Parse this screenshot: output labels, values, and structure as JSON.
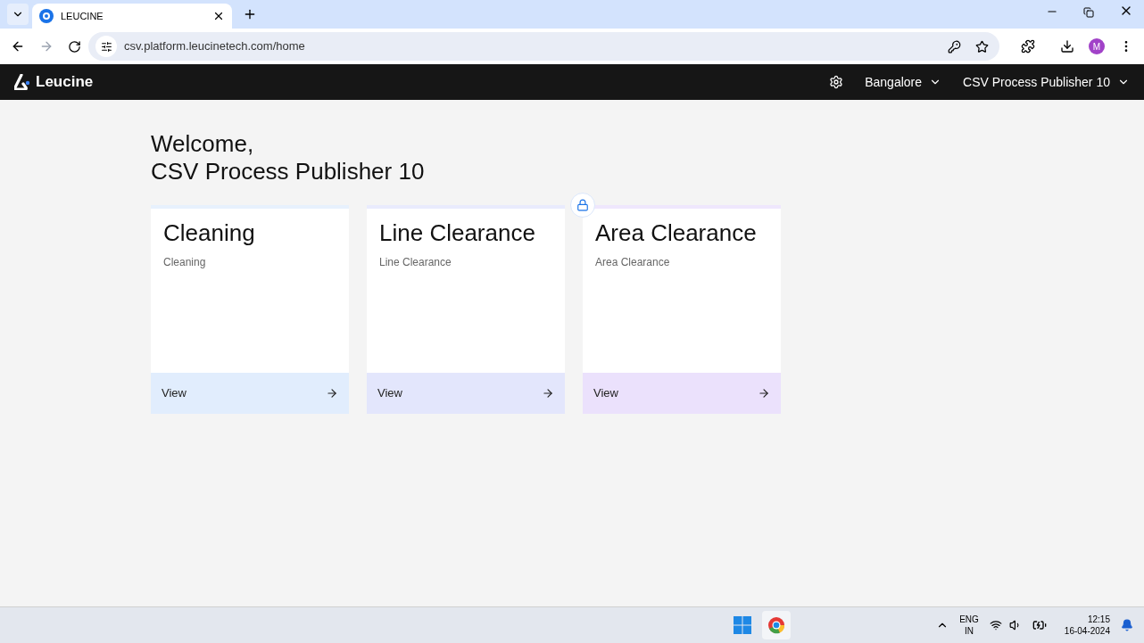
{
  "browser": {
    "tab_title": "LEUCINE",
    "url": "csv.platform.leucinetech.com/home",
    "profile_initial": "M"
  },
  "header": {
    "logo": "Leucine",
    "facility": "Bangalore",
    "user": "CSV Process Publisher 10"
  },
  "welcome": {
    "greeting": "Welcome,",
    "name": "CSV Process Publisher 10"
  },
  "cards": [
    {
      "title": "Cleaning",
      "subtitle": "Cleaning",
      "action": "View",
      "color": "#e1edfd",
      "locked": false
    },
    {
      "title": "Line Clearance",
      "subtitle": "Line Clearance",
      "action": "View",
      "color": "#e3e6fc",
      "locked": false
    },
    {
      "title": "Area Clearance",
      "subtitle": "Area Clearance",
      "action": "View",
      "color": "#ebe1fc",
      "locked": true
    }
  ],
  "taskbar": {
    "language": "ENG",
    "region": "IN",
    "time": "12:15",
    "date": "16-04-2024"
  }
}
